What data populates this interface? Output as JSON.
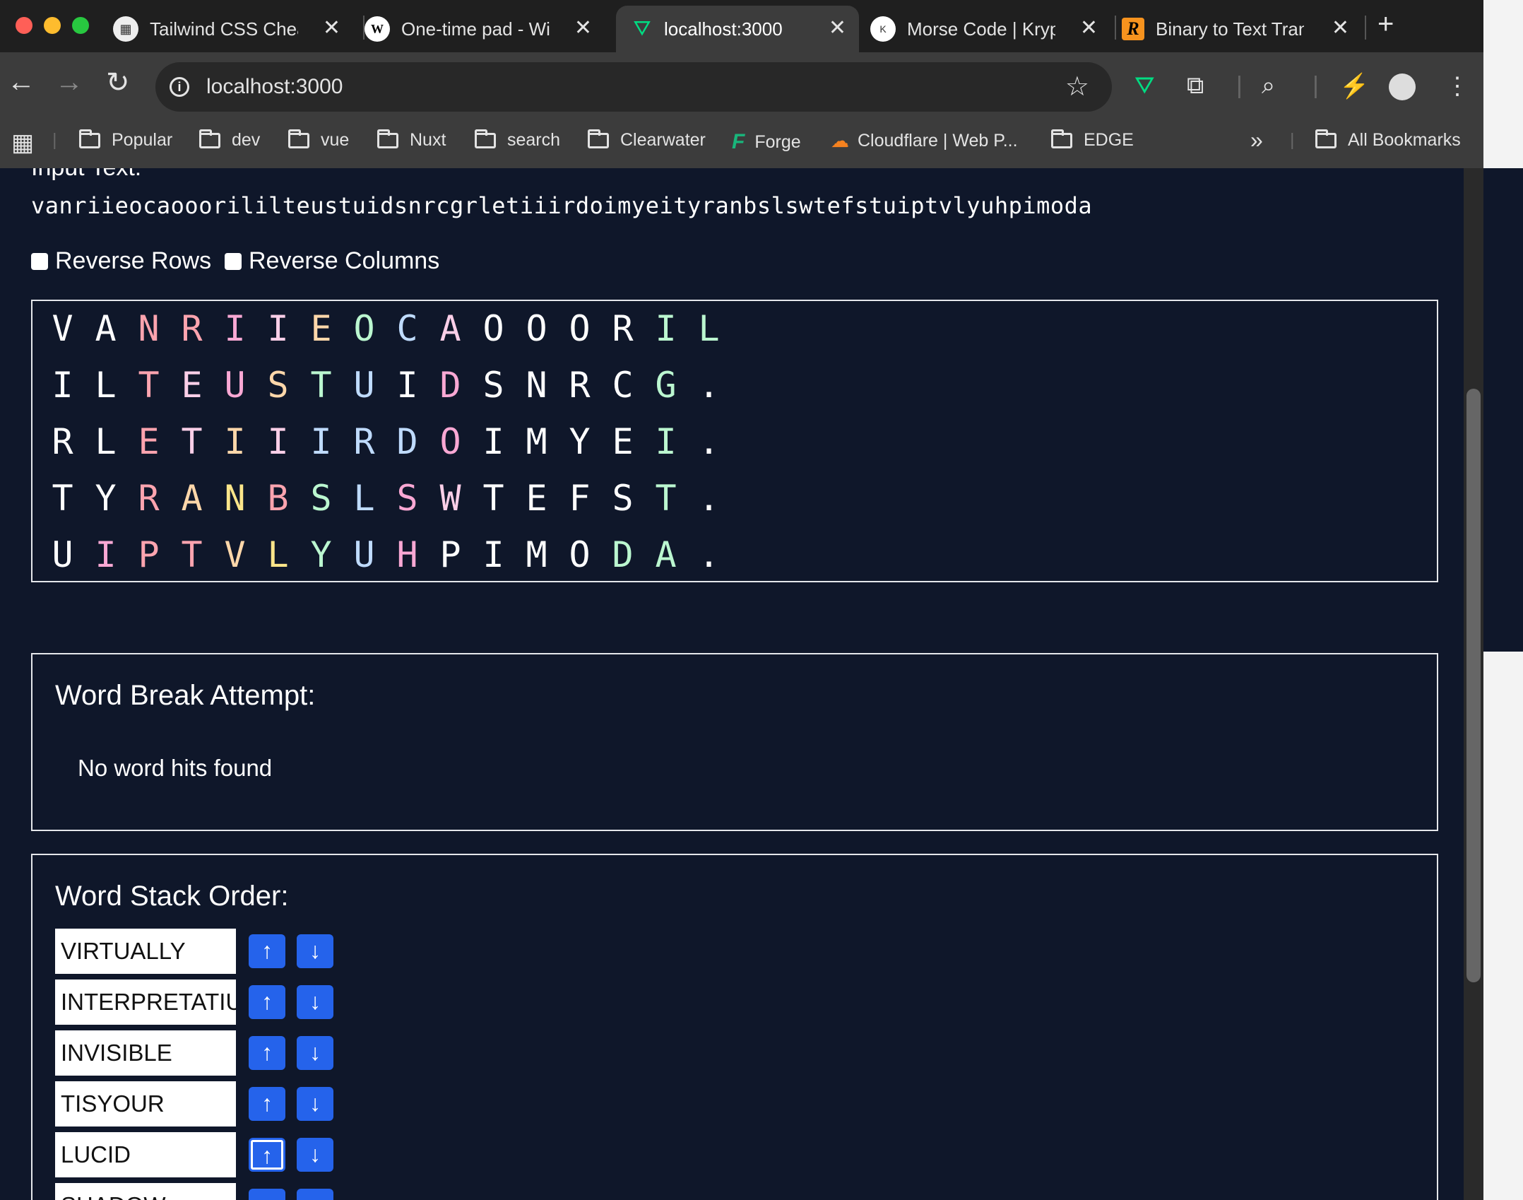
{
  "browser": {
    "tabs": [
      {
        "title": "Tailwind CSS Chea"
      },
      {
        "title": "One-time pad - Wi"
      },
      {
        "title": "localhost:3000"
      },
      {
        "title": "Morse Code | Kryp"
      },
      {
        "title": "Binary to Text Tran"
      }
    ],
    "url": "localhost:3000",
    "bookmarks": [
      "Popular",
      "dev",
      "vue",
      "Nuxt",
      "search",
      "Clearwater",
      "Forge",
      "Cloudflare | Web P...",
      "EDGE"
    ],
    "all_bookmarks": "All Bookmarks",
    "overflow": "»"
  },
  "page": {
    "input_label": "Input Text:",
    "input_text": "vanriieocaooorililteustuidsnrcgrletiiirdoimyeityranbslswtefstuiptvlyuhpimoda",
    "reverse_rows": "Reverse Rows",
    "reverse_columns": "Reverse Columns",
    "grid": [
      [
        "V",
        "A",
        "N",
        "R",
        "I",
        "I",
        "E",
        "O",
        "C",
        "A",
        "O",
        "O",
        "O",
        "R",
        "I",
        "L"
      ],
      [
        "I",
        "L",
        "T",
        "E",
        "U",
        "S",
        "T",
        "U",
        "I",
        "D",
        "S",
        "N",
        "R",
        "C",
        "G",
        "."
      ],
      [
        "R",
        "L",
        "E",
        "T",
        "I",
        "I",
        "I",
        "R",
        "D",
        "O",
        "I",
        "M",
        "Y",
        "E",
        "I",
        "."
      ],
      [
        "T",
        "Y",
        "R",
        "A",
        "N",
        "B",
        "S",
        "L",
        "S",
        "W",
        "T",
        "E",
        "F",
        "S",
        "T",
        "."
      ],
      [
        "U",
        "I",
        "P",
        "T",
        "V",
        "L",
        "Y",
        "U",
        "H",
        "P",
        "I",
        "M",
        "O",
        "D",
        "A",
        "."
      ]
    ],
    "grid_colors": [
      [
        "#ffffff",
        "#ffffff",
        "#fda4af",
        "#fda4af",
        "#f9a8d4",
        "#fbcfe8",
        "#fed7aa",
        "#bbf7d0",
        "#bfdbfe",
        "#fbcfe8",
        "#ffffff",
        "#ffffff",
        "#ffffff",
        "#ffffff",
        "#bbf7d0",
        "#bbf7d0"
      ],
      [
        "#ffffff",
        "#ffffff",
        "#fda4af",
        "#fbcfe8",
        "#f9a8d4",
        "#fed7aa",
        "#bbf7d0",
        "#bfdbfe",
        "#ffffff",
        "#f9a8d4",
        "#ffffff",
        "#ffffff",
        "#ffffff",
        "#ffffff",
        "#bbf7d0",
        "#ffffff"
      ],
      [
        "#ffffff",
        "#ffffff",
        "#fda4af",
        "#fbcfe8",
        "#fed7aa",
        "#fbcfe8",
        "#bfdbfe",
        "#bfdbfe",
        "#bfdbfe",
        "#f9a8d4",
        "#ffffff",
        "#ffffff",
        "#ffffff",
        "#ffffff",
        "#bbf7d0",
        "#ffffff"
      ],
      [
        "#ffffff",
        "#ffffff",
        "#fda4af",
        "#fed7aa",
        "#fde68a",
        "#fda4af",
        "#bbf7d0",
        "#bfdbfe",
        "#f9a8d4",
        "#fbcfe8",
        "#ffffff",
        "#ffffff",
        "#ffffff",
        "#ffffff",
        "#bbf7d0",
        "#ffffff"
      ],
      [
        "#ffffff",
        "#f9a8d4",
        "#fda4af",
        "#fda4af",
        "#fed7aa",
        "#fde68a",
        "#bbf7d0",
        "#bfdbfe",
        "#f9a8d4",
        "#ffffff",
        "#ffffff",
        "#ffffff",
        "#ffffff",
        "#bbf7d0",
        "#bbf7d0",
        "#ffffff"
      ]
    ],
    "word_break_title": "Word Break Attempt:",
    "no_hits": "No word hits found",
    "stack_title": "Word Stack Order:",
    "stack_words": [
      "VIRTUALLY",
      "INTERPRETATIU",
      "INVISIBLE",
      "TISYOUR",
      "LUCID",
      "SHADOW"
    ],
    "up_arrow": "↑",
    "down_arrow": "↓"
  }
}
